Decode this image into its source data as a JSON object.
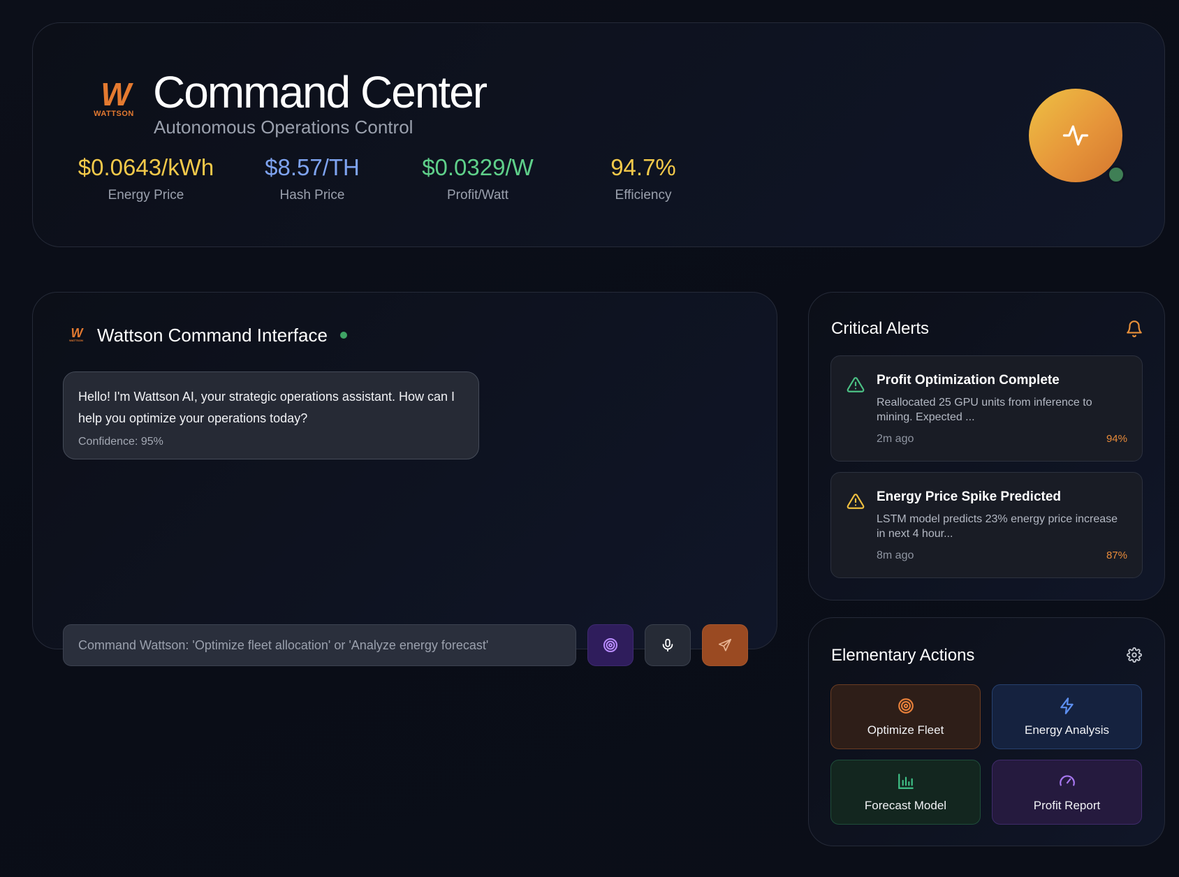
{
  "header": {
    "logo_text": "WATTSON",
    "title": "Command Center",
    "subtitle": "Autonomous Operations Control",
    "metrics": [
      {
        "value": "$0.0643/kWh",
        "label": "Energy Price",
        "color": "#f3c94a"
      },
      {
        "value": "$8.57/TH",
        "label": "Hash Price",
        "color": "#7ea3f0"
      },
      {
        "value": "$0.0329/W",
        "label": "Profit/Watt",
        "color": "#5fd08a"
      },
      {
        "value": "94.7%",
        "label": "Efficiency",
        "color": "#f3c94a"
      }
    ],
    "status_icon": "activity-pulse-icon",
    "status": "online"
  },
  "chat": {
    "logo_text": "WATTSON",
    "title": "Wattson Command Interface",
    "messages": [
      {
        "text": "Hello! I'm Wattson AI, your strategic operations assistant. How can I help you optimize your operations today?",
        "confidence": "Confidence: 95%"
      }
    ],
    "input": {
      "placeholder": "Command Wattson: 'Optimize fleet allocation' or 'Analyze energy forecast'",
      "value": ""
    },
    "buttons": {
      "target_icon": "target-icon",
      "mic_icon": "microphone-icon",
      "send_icon": "send-icon"
    }
  },
  "alerts": {
    "title": "Critical Alerts",
    "items": [
      {
        "title": "Profit Optimization Complete",
        "description": "Reallocated 25 GPU units from inference to mining. Expected ...",
        "time": "2m ago",
        "confidence": "94%",
        "icon_color": "#4cc185"
      },
      {
        "title": "Energy Price Spike Predicted",
        "description": "LSTM model predicts 23% energy price increase in next 4 hour...",
        "time": "8m ago",
        "confidence": "87%",
        "icon_color": "#f0c040"
      }
    ]
  },
  "actions": {
    "title": "Elementary Actions",
    "items": [
      {
        "label": "Optimize Fleet",
        "icon": "target-icon",
        "color": "#e8803a"
      },
      {
        "label": "Energy Analysis",
        "icon": "lightning-icon",
        "color": "#5d8ff0"
      },
      {
        "label": "Forecast Model",
        "icon": "bar-chart-icon",
        "color": "#3fc187"
      },
      {
        "label": "Profit Report",
        "icon": "gauge-icon",
        "color": "#a777f0"
      }
    ]
  },
  "colors": {
    "accent_orange": "#e47a30",
    "online_green": "#3fa465"
  }
}
